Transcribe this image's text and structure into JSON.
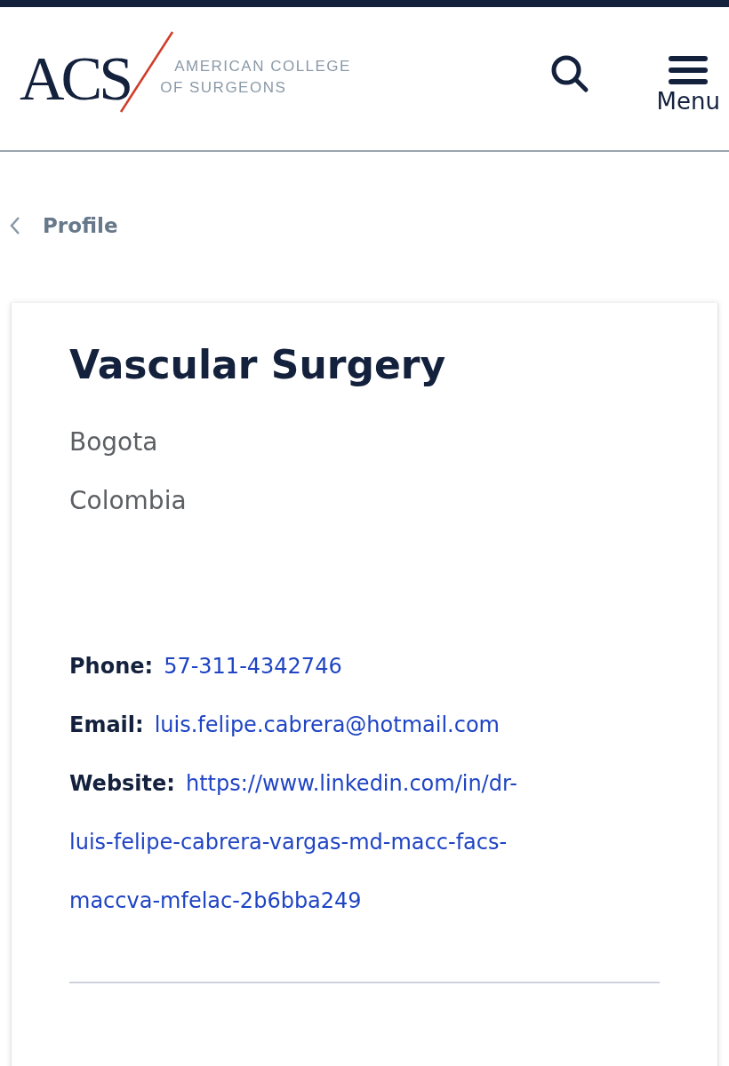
{
  "header": {
    "logo_mark": "ACS",
    "logo_line_1": "AMERICAN COLLEGE",
    "logo_line_2": "OF SURGEONS",
    "menu_label": "Menu"
  },
  "breadcrumb": {
    "label": "Profile"
  },
  "profile": {
    "specialty": "Vascular Surgery",
    "city": "Bogota",
    "country": "Colombia",
    "contacts": [
      {
        "label": "Phone:",
        "lines": [
          "57-311-4342746"
        ]
      },
      {
        "label": "Email:",
        "lines": [
          "luis.felipe.cabrera@hotmail.com"
        ]
      },
      {
        "label": "Website:",
        "lines": [
          "https://www.linkedin.com/in/dr-",
          "luis-felipe-cabrera-vargas-md-macc-facs-",
          "maccva-mfelac-2b6bba249"
        ]
      }
    ]
  }
}
